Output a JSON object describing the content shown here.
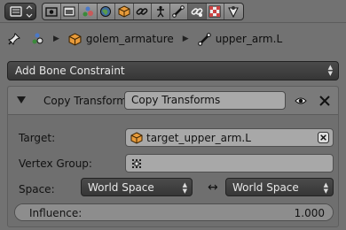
{
  "tabbar": {
    "editor_icon": "properties-editor-icon",
    "tabs": [
      {
        "icon": "render-icon"
      },
      {
        "icon": "render-layers-icon"
      },
      {
        "icon": "scene-icon"
      },
      {
        "icon": "world-icon"
      },
      {
        "icon": "object-icon"
      },
      {
        "icon": "object-constraints-icon"
      },
      {
        "icon": "object-data-armature-icon"
      },
      {
        "icon": "bone-icon"
      },
      {
        "icon": "bone-constraints-icon",
        "active": true
      },
      {
        "icon": "texture-icon"
      },
      {
        "icon": "physics-icon"
      }
    ]
  },
  "breadcrumb": {
    "object": "golem_armature",
    "bone": "upper_arm.L"
  },
  "add_constraint_label": "Add Bone Constraint",
  "constraint": {
    "type_label": "Copy Transforms",
    "name": "Copy Transforms",
    "target_label": "Target:",
    "target_value": "target_upper_arm.L",
    "vertex_group_label": "Vertex Group:",
    "vertex_group_value": "",
    "space_label": "Space:",
    "owner_space": "World Space",
    "target_space": "World Space",
    "swap_symbol": "↔",
    "influence_label": "Influence:",
    "influence_value": "1.000",
    "influence_fraction": 1.0
  },
  "colors": {
    "background": "#727272",
    "dark_button": "#3c3c3c",
    "field": "#a8a8a8",
    "object_orange": "#e89b3b",
    "active_tab": "#5a5a5a"
  }
}
